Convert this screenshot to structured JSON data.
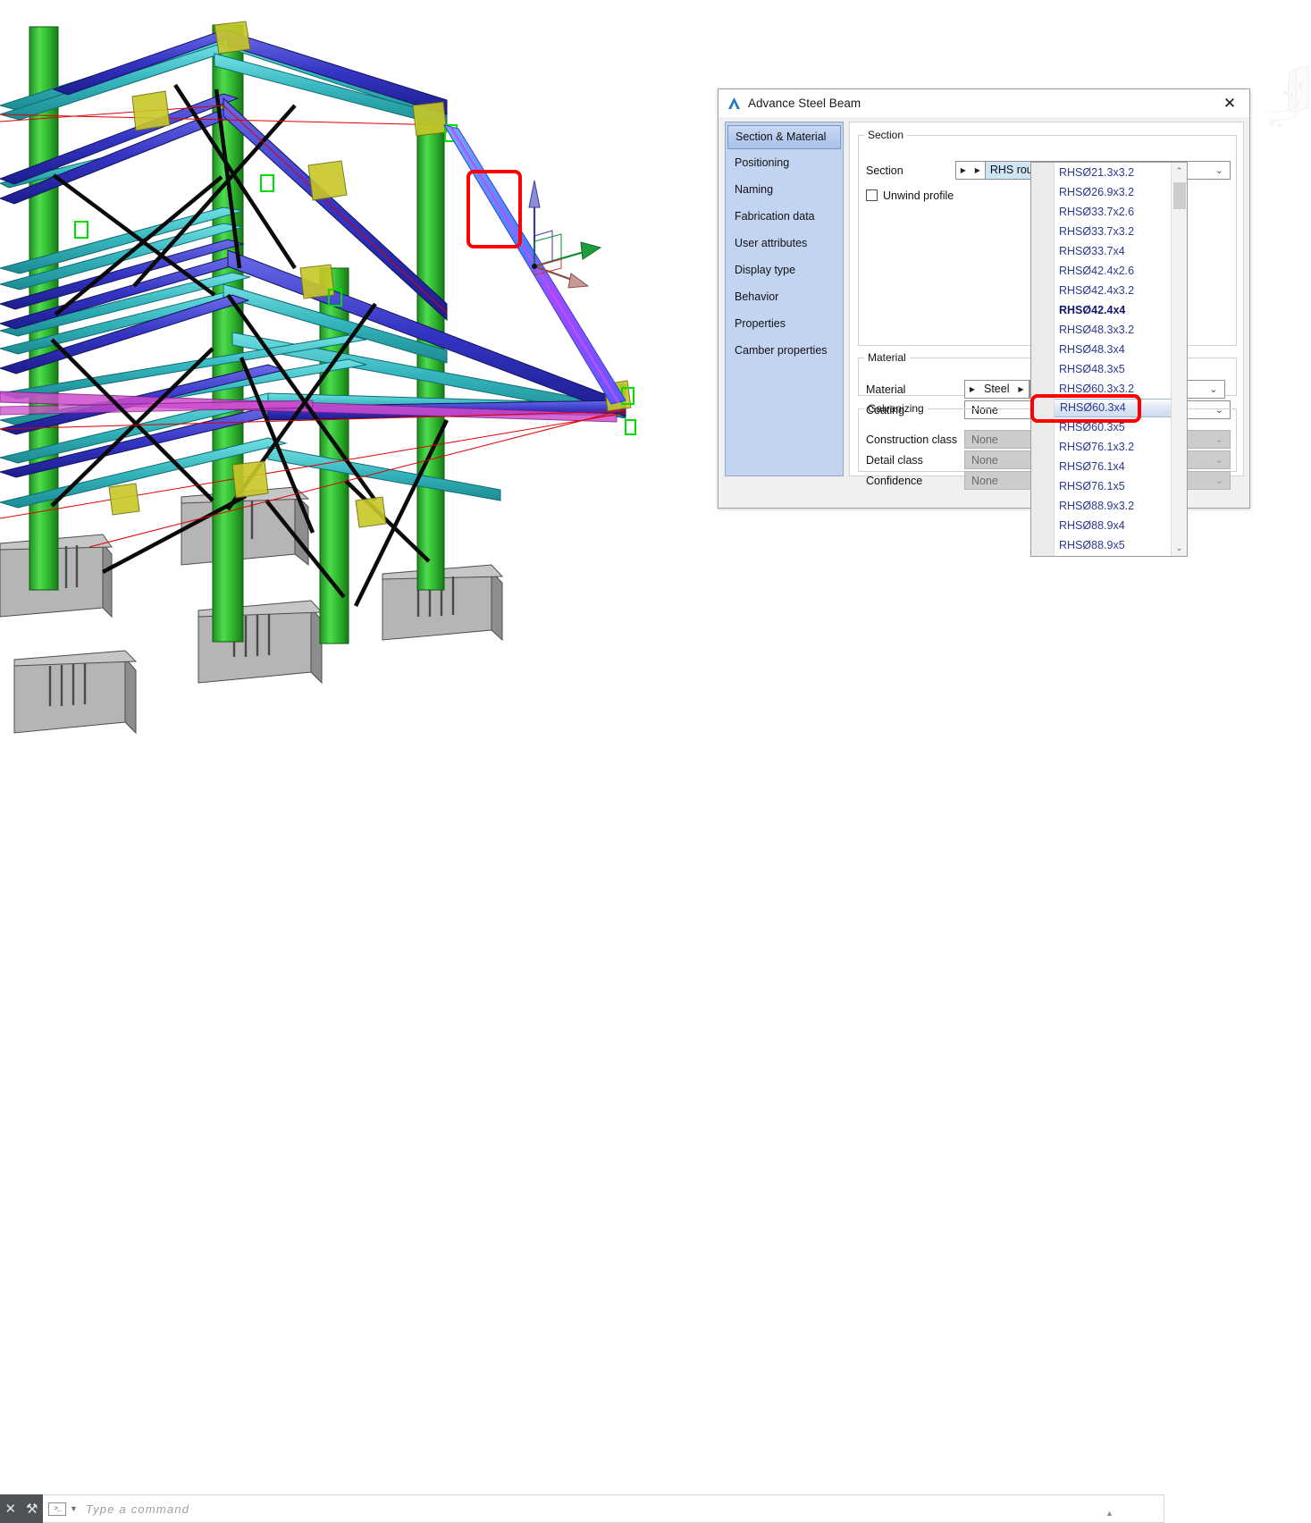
{
  "app": {
    "name": "Advance Steel",
    "viewport_name": "3d-model-viewport",
    "viewcube_label": "F"
  },
  "dialog": {
    "title": "Advance Steel   Beam",
    "logo_glyph": "A",
    "close_glyph": "✕",
    "sidebar": {
      "items": [
        {
          "label": "Section & Material",
          "active": true
        },
        {
          "label": "Positioning",
          "active": false
        },
        {
          "label": "Naming",
          "active": false
        },
        {
          "label": "Fabrication data",
          "active": false
        },
        {
          "label": "User attributes",
          "active": false
        },
        {
          "label": "Display type",
          "active": false
        },
        {
          "label": "Behavior",
          "active": false
        },
        {
          "label": "Properties",
          "active": false
        },
        {
          "label": "Camber properties",
          "active": false
        }
      ]
    },
    "groups": {
      "section": {
        "legend": "Section",
        "row_label": "Section",
        "prev_glyph": "▶",
        "next_glyph": "▶",
        "category": "RHS round",
        "category_drop_glyph": "▼",
        "value": "RHSØ42.4x4",
        "chevron": "⌄",
        "checkbox_label": "Unwind profile",
        "checkbox_checked": false
      },
      "material": {
        "legend": "Material",
        "rows": [
          {
            "label": "Material",
            "value": "Steel",
            "type": "nav",
            "prev_glyph": "▶",
            "next_glyph": "▶",
            "chevron": "⌄",
            "disabled": false
          },
          {
            "label": "Coating",
            "value": "None",
            "type": "combo",
            "chevron": "⌄",
            "disabled": false
          }
        ]
      },
      "galvanizing": {
        "legend": "Galvanizing",
        "rows": [
          {
            "label": "Construction class",
            "value": "None",
            "chevron": "⌄",
            "disabled": true
          },
          {
            "label": "Detail class",
            "value": "None",
            "chevron": "⌄",
            "disabled": true
          },
          {
            "label": "Confidence",
            "value": "None",
            "chevron": "⌄",
            "disabled": true
          }
        ]
      }
    }
  },
  "dropdown": {
    "name": "section-profile-list",
    "scroll_up_glyph": "⌃",
    "scroll_down_glyph": "⌄",
    "items": [
      {
        "label": "RHSØ21.3x3.2",
        "bold": false,
        "selected": false
      },
      {
        "label": "RHSØ26.9x3.2",
        "bold": false,
        "selected": false
      },
      {
        "label": "RHSØ33.7x2.6",
        "bold": false,
        "selected": false
      },
      {
        "label": "RHSØ33.7x3.2",
        "bold": false,
        "selected": false
      },
      {
        "label": "RHSØ33.7x4",
        "bold": false,
        "selected": false
      },
      {
        "label": "RHSØ42.4x2.6",
        "bold": false,
        "selected": false
      },
      {
        "label": "RHSØ42.4x3.2",
        "bold": false,
        "selected": false
      },
      {
        "label": "RHSØ42.4x4",
        "bold": true,
        "selected": false
      },
      {
        "label": "RHSØ48.3x3.2",
        "bold": false,
        "selected": false
      },
      {
        "label": "RHSØ48.3x4",
        "bold": false,
        "selected": false
      },
      {
        "label": "RHSØ48.3x5",
        "bold": false,
        "selected": false
      },
      {
        "label": "RHSØ60.3x3.2",
        "bold": false,
        "selected": false
      },
      {
        "label": "RHSØ60.3x4",
        "bold": false,
        "selected": true
      },
      {
        "label": "RHSØ60.3x5",
        "bold": false,
        "selected": false
      },
      {
        "label": "RHSØ76.1x3.2",
        "bold": false,
        "selected": false
      },
      {
        "label": "RHSØ76.1x4",
        "bold": false,
        "selected": false
      },
      {
        "label": "RHSØ76.1x5",
        "bold": false,
        "selected": false
      },
      {
        "label": "RHSØ88.9x3.2",
        "bold": false,
        "selected": false
      },
      {
        "label": "RHSØ88.9x4",
        "bold": false,
        "selected": false
      },
      {
        "label": "RHSØ88.9x5",
        "bold": false,
        "selected": false
      }
    ]
  },
  "command_bar": {
    "close_glyph": "✕",
    "wrench_glyph": "⚒",
    "prompt_icon_text": ">_",
    "caret_glyph": "▼",
    "placeholder": "Type a command",
    "grip_glyph": "▲"
  },
  "annotations": [
    {
      "name": "highlighted-beam-callout",
      "color": "#fe0000"
    },
    {
      "name": "highlighted-list-item-callout",
      "color": "#fe0000"
    }
  ],
  "colors": {
    "accent_blue": "#2b3990",
    "annotation_red": "#fe0000",
    "sidebar_bg": "#c3d4f2",
    "category_highlight": "#cde5f5",
    "column_green": "#2db52d",
    "beam_teal": "#3fc1c9",
    "beam_blue": "#3b3bd0",
    "selected_beam": "#4169ff",
    "foundation_gray": "#a8a8a8"
  }
}
